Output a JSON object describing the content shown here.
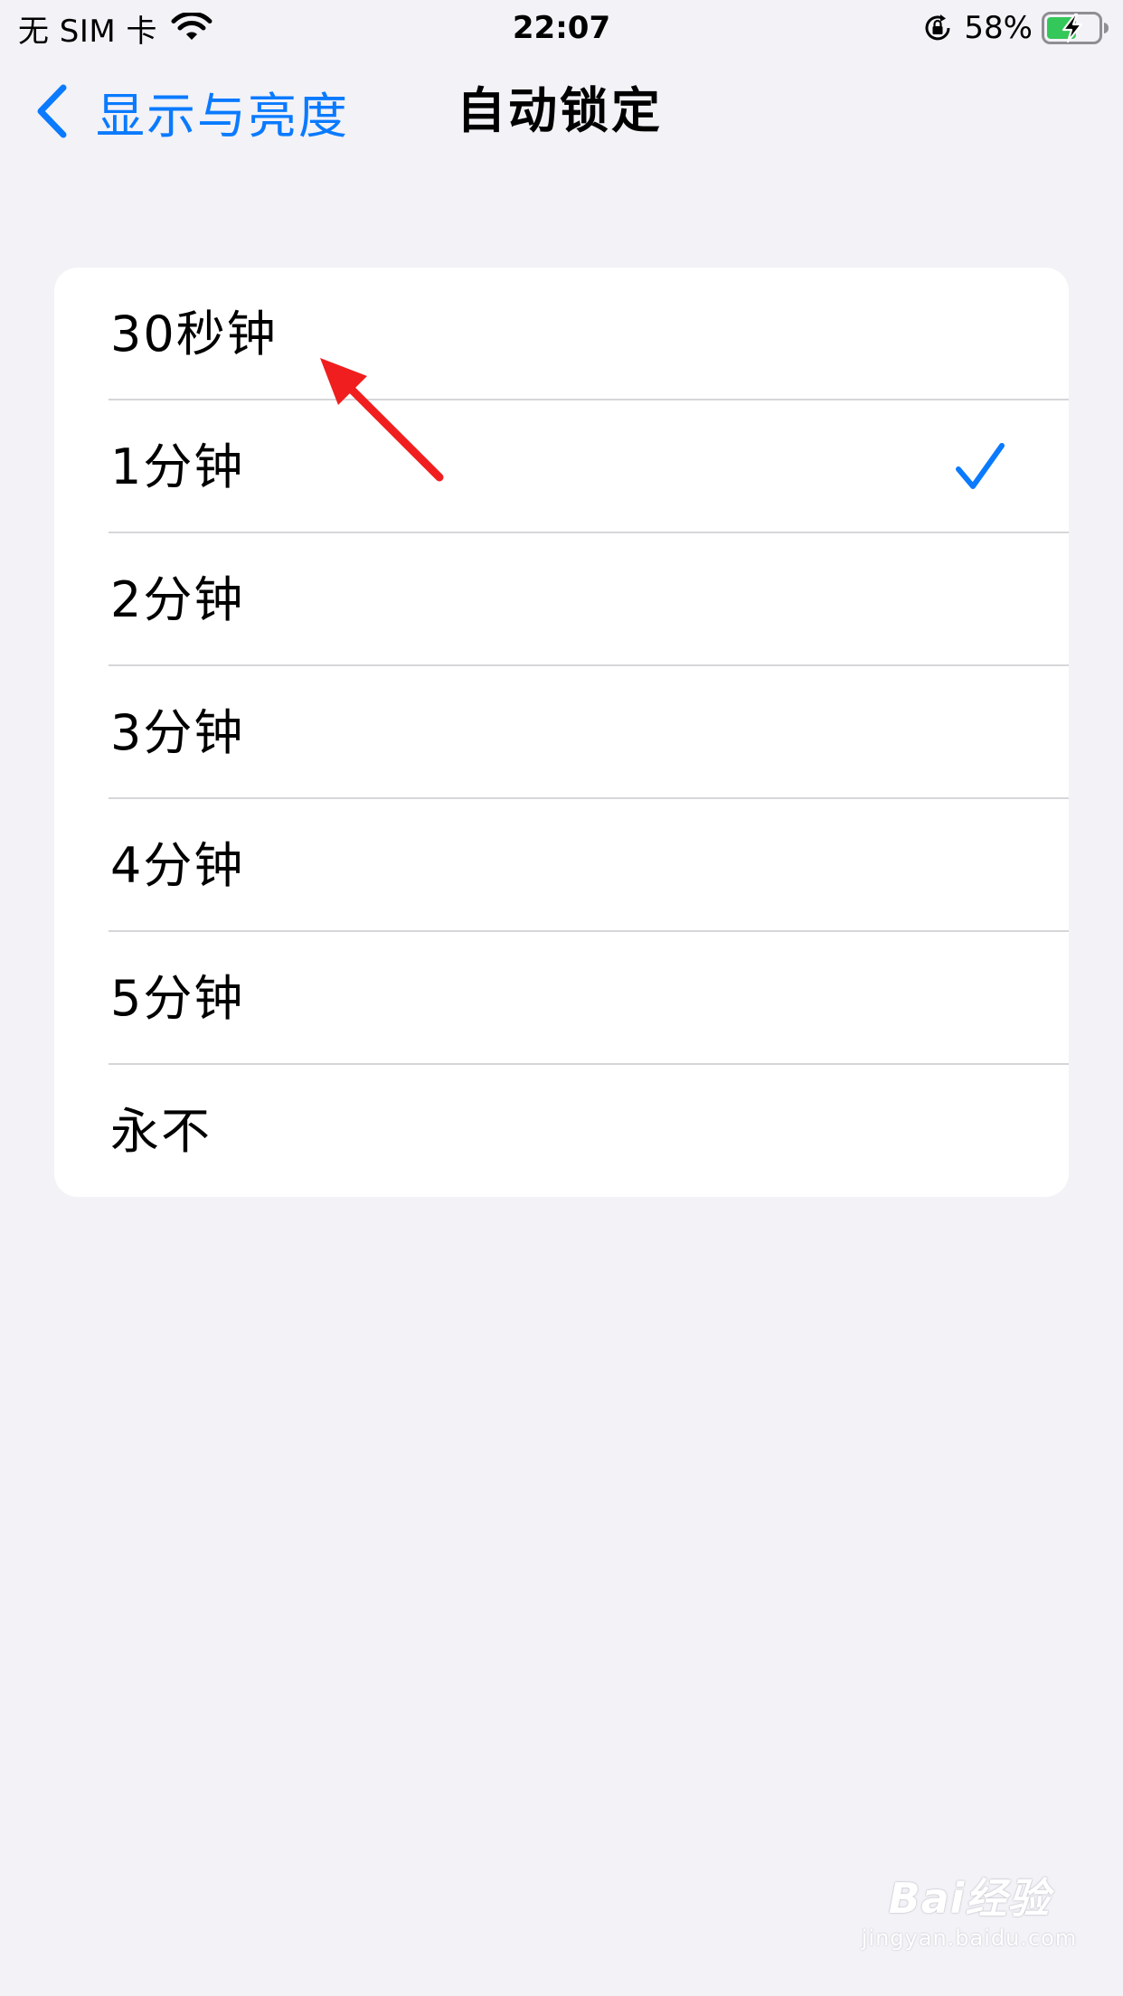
{
  "status_bar": {
    "carrier": "无 SIM 卡",
    "time": "22:07",
    "battery_percent": "58%",
    "battery_level": 0.58,
    "icons": [
      "wifi-icon",
      "orientation-lock-icon",
      "battery-charging-icon"
    ]
  },
  "nav": {
    "back_label": "显示与亮度",
    "title": "自动锁定",
    "accent_color": "#0A7AFF"
  },
  "options": [
    {
      "label": "30秒钟",
      "selected": false
    },
    {
      "label": "1分钟",
      "selected": true
    },
    {
      "label": "2分钟",
      "selected": false
    },
    {
      "label": "3分钟",
      "selected": false
    },
    {
      "label": "4分钟",
      "selected": false
    },
    {
      "label": "5分钟",
      "selected": false
    },
    {
      "label": "永不",
      "selected": false
    }
  ],
  "annotation": {
    "type": "red-arrow",
    "color": "#F01E1E",
    "points_to": "30秒钟"
  },
  "watermark": {
    "logo_text": "Bai经验",
    "url_text": "jingyan.baidu.com"
  }
}
